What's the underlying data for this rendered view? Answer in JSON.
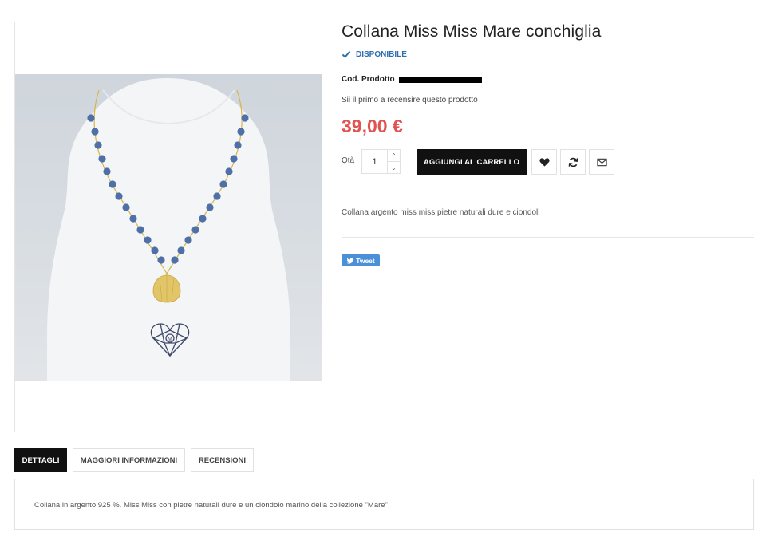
{
  "product": {
    "title": "Collana Miss Miss Mare conchiglia",
    "availability": "DISPONIBILE",
    "sku_label": "Cod. Prodotto",
    "review_link": "Sii il primo a recensire questo prodotto",
    "price": "39,00 €",
    "short_description": "Collana argento miss miss pietre naturali dure e ciondoli"
  },
  "purchase": {
    "qty_label": "Qtà",
    "qty_value": "1",
    "add_to_cart_label": "AGGIUNGI AL CARRELLO"
  },
  "actions": {
    "wishlist_icon": "heart-icon",
    "compare_icon": "refresh-icon",
    "email_icon": "envelope-icon"
  },
  "social": {
    "tweet_label": "Tweet"
  },
  "tabs": [
    {
      "label": "DETTAGLI",
      "active": true
    },
    {
      "label": "MAGGIORI INFORMAZIONI",
      "active": false
    },
    {
      "label": "RECENSIONI",
      "active": false
    }
  ],
  "details_text": "Collana in argento 925 %. Miss Miss con pietre naturali dure e un ciondolo marino della collezione \"Mare\"",
  "colors": {
    "price": "#e05353",
    "availability": "#2e6fb0",
    "button_dark": "#111111",
    "tweet": "#4a90d9",
    "bead": "#4f6fa8",
    "gold": "#d6b54a"
  }
}
